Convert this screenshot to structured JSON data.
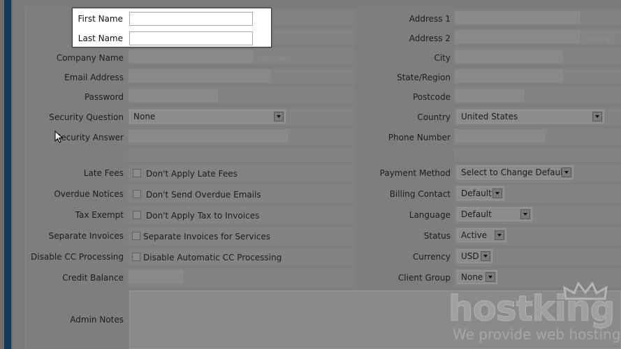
{
  "highlighted": {
    "first_name_label": "First Name",
    "last_name_label": "Last Name",
    "first_name_value": "",
    "last_name_value": ""
  },
  "left": {
    "company_name_label": "Company Name",
    "optional_hint": "(Optional)",
    "email_label": "Email Address",
    "password_label": "Password",
    "security_question_label": "Security Question",
    "security_question_value": "None",
    "security_answer_label": "Security Answer",
    "late_fees_label": "Late Fees",
    "late_fees_text": "Don't Apply Late Fees",
    "overdue_label": "Overdue Notices",
    "overdue_text": "Don't Send Overdue Emails",
    "tax_label": "Tax Exempt",
    "tax_text": "Don't Apply Tax to Invoices",
    "separate_label": "Separate Invoices",
    "separate_text": "Separate Invoices for Services",
    "disable_cc_label": "Disable CC Processing",
    "disable_cc_text": "Disable Automatic CC Processing",
    "credit_label": "Credit Balance",
    "admin_notes_label": "Admin Notes"
  },
  "right": {
    "address1_label": "Address 1",
    "address2_label": "Address 2",
    "optional_hint": "(Optional)",
    "city_label": "City",
    "state_label": "State/Region",
    "postcode_label": "Postcode",
    "country_label": "Country",
    "country_value": "United States",
    "phone_label": "Phone Number",
    "payment_label": "Payment Method",
    "payment_value": "Select to Change Default",
    "billing_label": "Billing Contact",
    "billing_value": "Default",
    "language_label": "Language",
    "language_value": "Default",
    "status_label": "Status",
    "status_value": "Active",
    "currency_label": "Currency",
    "currency_value": "USD",
    "group_label": "Client Group",
    "group_value": "None"
  },
  "watermark": {
    "brand": "hostking",
    "tagline": "We provide web hosting"
  }
}
